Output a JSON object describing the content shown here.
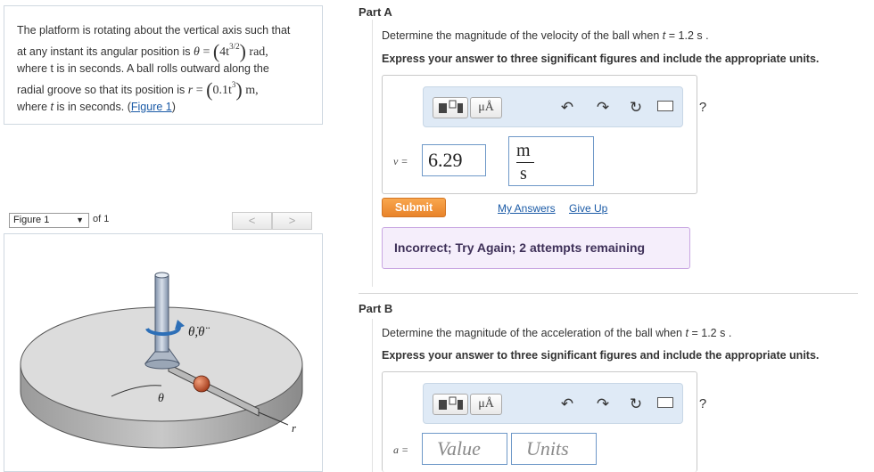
{
  "problem": {
    "line1": "The platform is rotating about the vertical axis such that",
    "line2_prefix": "at any instant its angular position is",
    "theta_symbol": "θ",
    "theta_eq": "=",
    "theta_coef": "4t",
    "theta_exp": "3/2",
    "theta_unit": "rad,",
    "line3": "where t is in seconds. A ball rolls outward along the",
    "line4_prefix": "radial groove so that its position is",
    "r_symbol": "r",
    "r_eq": "=",
    "r_coef": "0.1t",
    "r_exp": "3",
    "r_unit": "m,",
    "line5_prefix": "where",
    "line5_t": "t",
    "line5_mid": "is in seconds. (",
    "figure_link": "Figure 1",
    "line5_suffix": ")"
  },
  "figure": {
    "select_label": "Figure 1",
    "of_label": "of 1",
    "prev": "<",
    "next": ">",
    "theta_dots_label": "θ̇,θ̈",
    "theta_label": "θ",
    "r_label": "r"
  },
  "partA": {
    "title": "Part A",
    "question_prefix": "Determine the magnitude of the velocity of the ball when",
    "question_var": "t",
    "question_suffix": "= 1.2 s .",
    "instruction": "Express your answer to three significant figures and include the appropriate units.",
    "var_label": "v =",
    "value": "6.29",
    "unit_num": "m",
    "unit_den": "s",
    "submit_label": "Submit",
    "my_answers": "My Answers",
    "give_up": "Give Up",
    "feedback": "Incorrect; Try Again; 2 attempts remaining"
  },
  "partB": {
    "title": "Part B",
    "question_prefix": "Determine the magnitude of the acceleration of the ball when",
    "question_var": "t",
    "question_suffix": "= 1.2 s .",
    "instruction": "Express your answer to three significant figures and include the appropriate units.",
    "var_label": "a =",
    "value_placeholder": "Value",
    "units_placeholder": "Units"
  },
  "toolbar": {
    "units_label": "μÅ",
    "undo_icon": "↶",
    "redo_icon": "↷",
    "reset_icon": "↻",
    "help_label": "?"
  }
}
